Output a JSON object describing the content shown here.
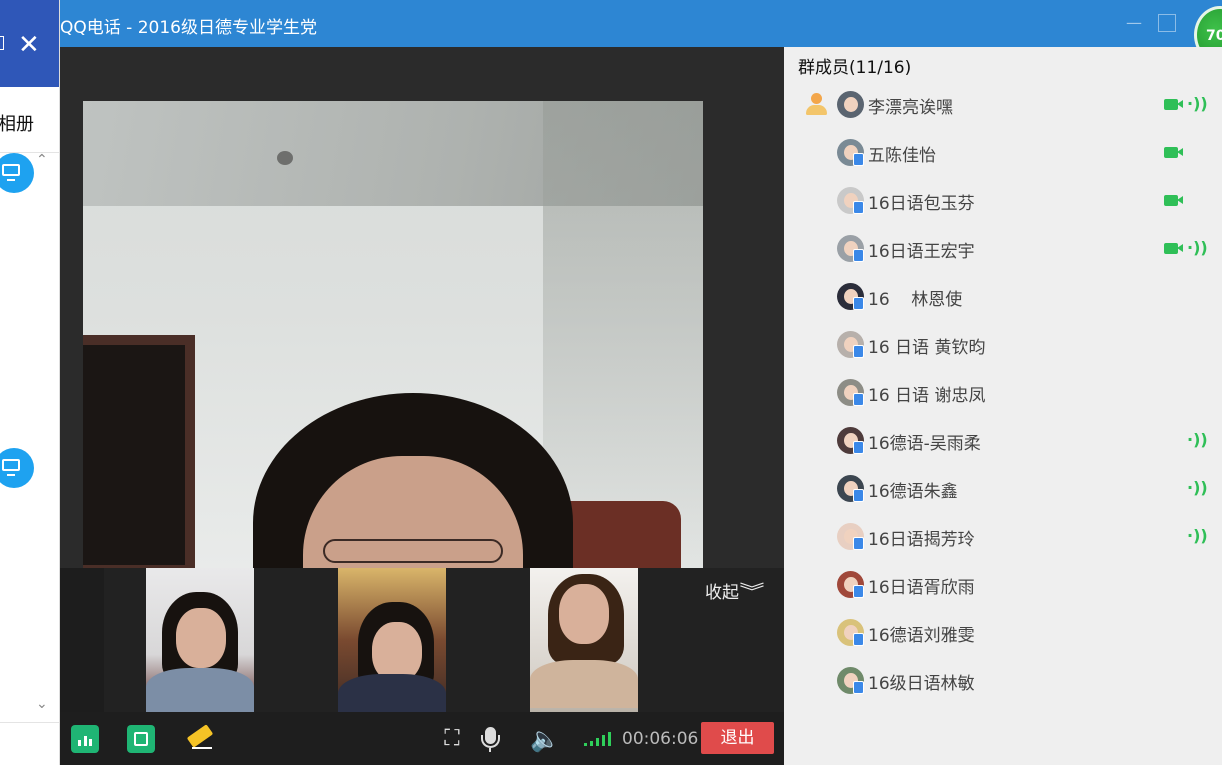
{
  "window": {
    "title": "QQ电话 - 2016级日德专业学生党",
    "badge": "70",
    "minimize_icon": "minimize-icon",
    "maximize_icon": "maximize-icon"
  },
  "left_panel": {
    "album_label": "相册",
    "close_icon": "close-icon",
    "computer_icon": "computer-icon"
  },
  "video": {
    "collapse_label": "收起",
    "collapse_icon": "double-chevron-down-icon"
  },
  "toolbar": {
    "timer": "00:06:06",
    "exit_label": "退出",
    "exit_color": "#e04b4b",
    "icons": [
      "stats-icon",
      "screen-share-icon",
      "eraser-icon",
      "fullscreen-icon",
      "microphone-icon",
      "speaker-icon",
      "signal-icon"
    ]
  },
  "members": {
    "header": "群成员(11/16)",
    "list": [
      {
        "name": "李漂亮诶嘿",
        "video": true,
        "speaking": true,
        "self": true
      },
      {
        "name": "五陈佳怡",
        "video": true,
        "speaking": false
      },
      {
        "name": "16日语包玉芬",
        "video": true,
        "speaking": false
      },
      {
        "name": "16日语王宏宇",
        "video": true,
        "speaking": true
      },
      {
        "name": "16    林恩使",
        "video": false,
        "speaking": false
      },
      {
        "name": "16 日语 黄钦昀",
        "video": false,
        "speaking": false
      },
      {
        "name": "16 日语 谢忠凤",
        "video": false,
        "speaking": false
      },
      {
        "name": "16德语-吴雨柔",
        "video": false,
        "speaking": true
      },
      {
        "name": "16德语朱鑫",
        "video": false,
        "speaking": true
      },
      {
        "name": "16日语揭芳玲",
        "video": false,
        "speaking": true
      },
      {
        "name": "16日语胥欣雨",
        "video": false,
        "speaking": false
      },
      {
        "name": "16德语刘雅雯",
        "video": false,
        "speaking": false
      },
      {
        "name": "16级日语林敏",
        "video": false,
        "speaking": false
      }
    ],
    "accent_green": "#2fbf57"
  }
}
